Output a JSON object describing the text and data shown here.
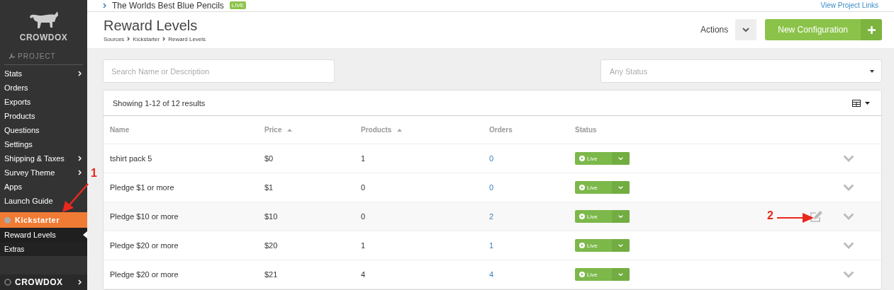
{
  "sidebar": {
    "logo": "CROWDOX",
    "section": "PROJECT",
    "items": [
      {
        "label": "Stats",
        "has_submenu": true
      },
      {
        "label": "Orders",
        "has_submenu": false
      },
      {
        "label": "Exports",
        "has_submenu": false
      },
      {
        "label": "Products",
        "has_submenu": false
      },
      {
        "label": "Questions",
        "has_submenu": false
      },
      {
        "label": "Settings",
        "has_submenu": false
      },
      {
        "label": "Shipping & Taxes",
        "has_submenu": true
      },
      {
        "label": "Survey Theme",
        "has_submenu": true
      },
      {
        "label": "Apps",
        "has_submenu": false
      },
      {
        "label": "Launch Guide",
        "has_submenu": false
      }
    ],
    "source": {
      "label": "Kickstarter",
      "selected": true,
      "annotation": "1"
    },
    "source_items": [
      {
        "label": "Reward Levels",
        "selected": true
      },
      {
        "label": "Extras",
        "selected": false
      }
    ],
    "footer": "CROWDOX"
  },
  "top_bar": {
    "project": "The Worlds Best Blue Pencils",
    "badge": "LIVE",
    "link": "View Project Links"
  },
  "header": {
    "title": "Reward Levels",
    "breadcrumbs": [
      "Sources",
      "Kickstarter",
      "Reward Levels"
    ],
    "actions": "Actions",
    "primary_button": "New Configuration"
  },
  "filters": {
    "search": {
      "placeholder": "Search Name or Description"
    },
    "status": {
      "placeholder": "Any Status"
    }
  },
  "table": {
    "summary": "Showing 1-12 of 12 results",
    "columns": [
      {
        "label": "Name",
        "sortable": false
      },
      {
        "label": "Price",
        "sortable": true
      },
      {
        "label": "Products",
        "sortable": true
      },
      {
        "label": "Orders",
        "sortable": false
      },
      {
        "label": "Status",
        "sortable": false
      }
    ],
    "rows": [
      {
        "name": "tshirt pack 5",
        "price": "$0",
        "products": "1",
        "orders": "0",
        "status": "Live",
        "highlighted": false
      },
      {
        "name": "Pledge $1 or more",
        "price": "$1",
        "products": "0",
        "orders": "0",
        "status": "Live",
        "highlighted": false
      },
      {
        "name": "Pledge $10 or more",
        "price": "$10",
        "products": "0",
        "orders": "2",
        "status": "Live",
        "highlighted": true,
        "annotation": "2"
      },
      {
        "name": "Pledge $20 or more",
        "price": "$20",
        "products": "1",
        "orders": "1",
        "status": "Live",
        "highlighted": false
      },
      {
        "name": "Pledge $20 or more",
        "price": "$21",
        "products": "4",
        "orders": "4",
        "status": "Live",
        "highlighted": false
      }
    ]
  }
}
